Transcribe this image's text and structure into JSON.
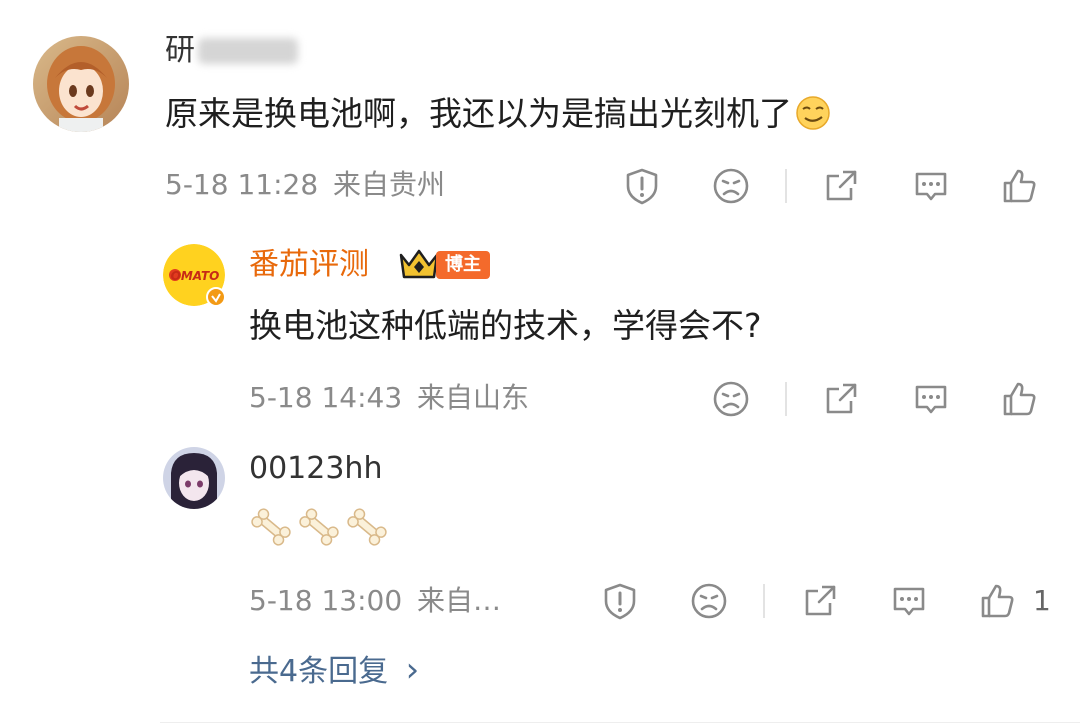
{
  "comment1": {
    "username": "研",
    "text": "原来是换电池啊，我还以为是搞出光刻机了",
    "emoji_icon": "smirk-emoji",
    "date": "5-18 11:28",
    "location": "来自贵州"
  },
  "reply1": {
    "username": "番茄评测",
    "username_color": "#e8690b",
    "badge": "博主",
    "avatar_text": "OMATO",
    "text": "换电池这种低端的技术，学得会不?",
    "date": "5-18 14:43",
    "location": "来自山东"
  },
  "reply2": {
    "username": "00123hh",
    "emoji_icons": [
      "bone-emoji",
      "bone-emoji",
      "bone-emoji"
    ],
    "date": "5-18 13:00",
    "location": "来自…",
    "like_count": "1"
  },
  "more_replies": {
    "label": "共4条回复",
    "arrow": "›"
  },
  "colors": {
    "icon": "#8a8a8a",
    "meta_text": "#8a8a8a",
    "link": "#4a6a8f",
    "brand": "#e8690b"
  }
}
